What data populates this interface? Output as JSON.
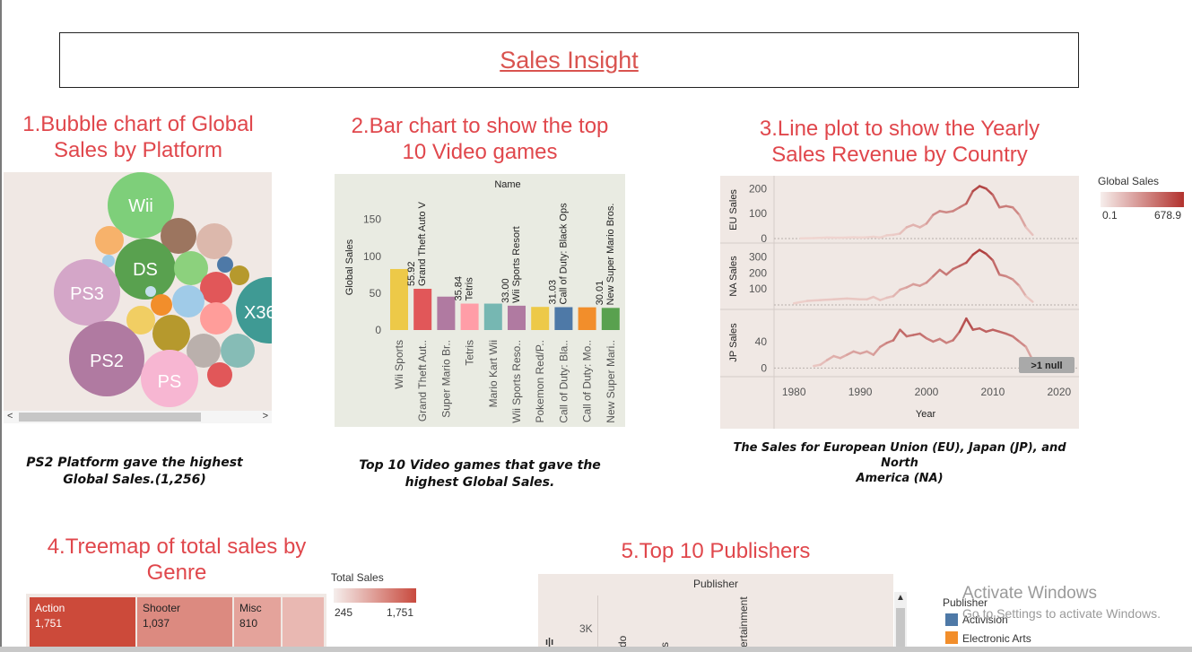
{
  "header": {
    "title": "Sales Insight"
  },
  "sections": {
    "bubble": {
      "title_line1": "1.Bubble chart of Global",
      "title_line2": "Sales by Platform",
      "caption_line1": "PS2 Platform gave the highest",
      "caption_line2": "Global Sales.(1,256)"
    },
    "bar": {
      "title_line1": "2.Bar chart to show the top",
      "title_line2": "10 Video games",
      "caption_line1": "Top 10 Video games that gave the",
      "caption_line2": "highest Global Sales."
    },
    "line": {
      "title_line1": "3.Line plot to show the Yearly",
      "title_line2": "Sales Revenue by Country",
      "caption_line1": "The Sales for European Union (EU), Japan (JP), and North",
      "caption_line2": "America (NA)"
    },
    "treemap": {
      "title_line1": "4.Treemap of total sales by",
      "title_line2": "Genre"
    },
    "publishers": {
      "title": "5.Top 10 Publishers"
    }
  },
  "chart_data": [
    {
      "type": "scatter",
      "subtype": "bubble",
      "title": "",
      "labels": [
        "Wii",
        "DS",
        "PS3",
        "PS2",
        "PS",
        "X36"
      ],
      "colors": {
        "Wii": "#7ecf7a",
        "DS": "#59a14f",
        "PS3": "#d4a6c8",
        "PS2": "#b07aa1",
        "PS": "#f7b6d2",
        "X36": "#3f9a94"
      },
      "values": {
        "PS2": 1256
      },
      "scroll_arrows": [
        "<",
        ">"
      ]
    },
    {
      "type": "bar",
      "title": "Name",
      "ylabel": "Global Sales",
      "ylim": [
        0,
        180
      ],
      "yticks": [
        0,
        50,
        100,
        150
      ],
      "categories": [
        "Wii Sports",
        "Grand Theft Aut..",
        "Super Mario Br..",
        "Tetris",
        "Mario Kart Wii",
        "Wii Sports Reso..",
        "Pokemon Red/P..",
        "Call of Duty: Bla..",
        "Call of Duty: Mo..",
        "New Super Mari.."
      ],
      "values": [
        82.74,
        55.92,
        45.31,
        35.84,
        35.82,
        33.0,
        31.37,
        31.03,
        30.83,
        30.01
      ],
      "colors": [
        "#edc948",
        "#e15759",
        "#b07aa1",
        "#ff9da7",
        "#76b7b2",
        "#b07aa1",
        "#edc948",
        "#4e79a7",
        "#f28e2b",
        "#59a14f"
      ],
      "annotations": [
        {
          "index": 1,
          "value": "55.92",
          "label": "Grand Theft Auto V"
        },
        {
          "index": 3,
          "value": "35.84",
          "label": "Tetris"
        },
        {
          "index": 5,
          "value": "33.00",
          "label": "Wii Sports Resort"
        },
        {
          "index": 7,
          "value": "31.03",
          "label": "Call of Duty: Black Ops"
        },
        {
          "index": 9,
          "value": "30.01",
          "label": "New Super Mario Bros."
        }
      ]
    },
    {
      "type": "line",
      "xlabel": "Year",
      "xticks": [
        1980,
        1990,
        2000,
        2010,
        2020
      ],
      "legend_title": "Global Sales",
      "legend_min": "0.1",
      "legend_max": "678.9",
      "null_badge": ">1 null",
      "series": [
        {
          "name": "EU Sales",
          "yticks": [
            0,
            100,
            200
          ],
          "ylim": [
            0,
            230
          ],
          "x": [
            1981,
            1983,
            1985,
            1987,
            1989,
            1990,
            1991,
            1992,
            1993,
            1994,
            1995,
            1996,
            1997,
            1998,
            1999,
            2000,
            2001,
            2002,
            2003,
            2004,
            2005,
            2006,
            2007,
            2008,
            2009,
            2010,
            2011,
            2012,
            2013,
            2014,
            2015,
            2016
          ],
          "y": [
            1,
            2,
            4,
            3,
            5,
            4,
            5,
            7,
            4,
            13,
            15,
            20,
            45,
            55,
            45,
            60,
            95,
            110,
            105,
            110,
            125,
            140,
            190,
            210,
            200,
            175,
            125,
            130,
            125,
            95,
            45,
            15
          ]
        },
        {
          "name": "NA Sales",
          "yticks": [
            100,
            200,
            300
          ],
          "ylim": [
            0,
            360
          ],
          "x": [
            1980,
            1982,
            1984,
            1986,
            1988,
            1990,
            1991,
            1992,
            1993,
            1994,
            1995,
            1996,
            1997,
            1998,
            1999,
            2000,
            2001,
            2002,
            2003,
            2004,
            2005,
            2006,
            2007,
            2008,
            2009,
            2010,
            2011,
            2012,
            2013,
            2014,
            2015,
            2016
          ],
          "y": [
            10,
            25,
            30,
            35,
            40,
            35,
            35,
            50,
            30,
            45,
            55,
            95,
            110,
            130,
            120,
            140,
            180,
            220,
            190,
            225,
            245,
            265,
            315,
            345,
            320,
            280,
            190,
            180,
            160,
            120,
            55,
            20
          ]
        },
        {
          "name": "JP Sales",
          "yticks": [
            0,
            40
          ],
          "ylim": [
            -5,
            82
          ],
          "x": [
            1983,
            1984,
            1985,
            1986,
            1987,
            1988,
            1989,
            1990,
            1991,
            1992,
            1993,
            1994,
            1995,
            1996,
            1997,
            1998,
            1999,
            2000,
            2001,
            2002,
            2003,
            2004,
            2005,
            2006,
            2007,
            2008,
            2009,
            2010,
            2011,
            2012,
            2013,
            2014,
            2015,
            2016
          ],
          "y": [
            3,
            5,
            12,
            18,
            15,
            20,
            25,
            22,
            25,
            20,
            32,
            38,
            42,
            58,
            48,
            50,
            52,
            45,
            40,
            44,
            38,
            42,
            55,
            75,
            58,
            60,
            55,
            58,
            55,
            52,
            48,
            40,
            32,
            12
          ]
        }
      ]
    },
    {
      "type": "heatmap",
      "subtype": "treemap",
      "legend_title": "Total Sales",
      "legend_min": "245",
      "legend_max": "1,751",
      "categories": [
        "Action",
        "Shooter",
        "Misc"
      ],
      "values": [
        "1,751",
        "1,037",
        "810"
      ],
      "colors": [
        "#cc4a3a",
        "#dc8a80",
        "#e4a39b"
      ]
    },
    {
      "type": "bar",
      "title": "Publisher",
      "ytick": "3K",
      "legend_title": "Publisher",
      "legend_items": [
        {
          "name": "Activision",
          "color": "#4e79a7"
        },
        {
          "name": "Electronic Arts",
          "color": "#f28e2b"
        }
      ],
      "partial_labels": [
        "do",
        "s",
        "ertainment"
      ]
    }
  ],
  "watermark": {
    "line1": "Activate Windows",
    "line2": "Go to Settings to activate Windows."
  },
  "colors": {
    "title_red": "#e0474c",
    "panel_bg": "#f0e8e4",
    "line_color": "#b7413a"
  }
}
